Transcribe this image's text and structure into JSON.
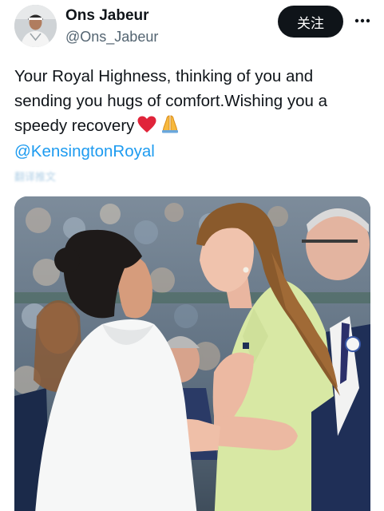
{
  "author": {
    "display_name": "Ons Jabeur",
    "handle": "@Ons_Jabeur"
  },
  "follow_button": {
    "label": "关注"
  },
  "more_button": {
    "icon": "more-horizontal-icon"
  },
  "tweet": {
    "lines": [
      "Your Royal Highness, thinking of you and",
      "sending you hugs of comfort.Wishing you a",
      "speedy recovery"
    ],
    "emojis": [
      "red-heart-icon",
      "folded-hands-icon"
    ],
    "mention": "@KensingtonRoyal",
    "translate_label": "翻译推文"
  },
  "colors": {
    "text": "#0f1419",
    "secondary": "#536471",
    "link": "#1d9bf0",
    "button_bg": "#0f1419"
  }
}
